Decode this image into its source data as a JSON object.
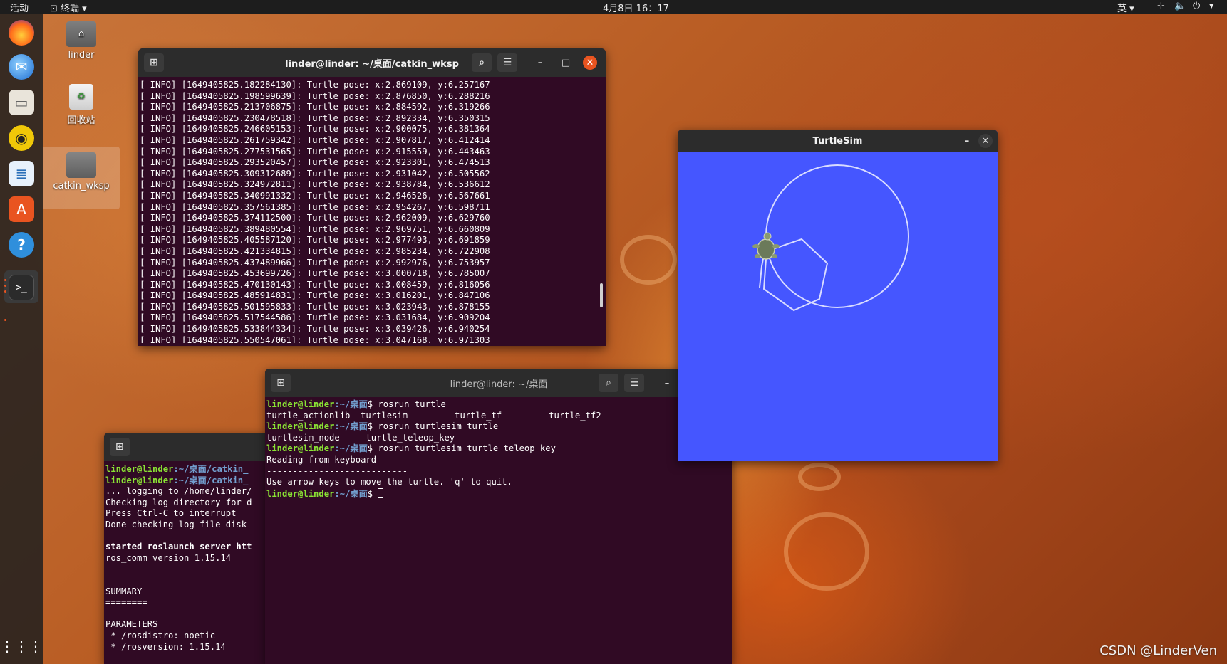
{
  "topbar": {
    "activities": "活动",
    "app_menu": "终端 ▾",
    "clock": "4月8日  16：17",
    "input_method": "英 ▾",
    "status_arrow": "▾"
  },
  "desktop": {
    "icons": [
      {
        "label": "linder"
      },
      {
        "label": "回收站"
      },
      {
        "label": "catkin_wksp"
      }
    ],
    "watermark": "CSDN @LinderVen"
  },
  "term1": {
    "title": "linder@linder: ~/桌面/catkin_wksp",
    "lines": [
      "[ INFO] [1649405825.182284130]: Turtle pose: x:2.869109, y:6.257167",
      "[ INFO] [1649405825.198599639]: Turtle pose: x:2.876850, y:6.288216",
      "[ INFO] [1649405825.213706875]: Turtle pose: x:2.884592, y:6.319266",
      "[ INFO] [1649405825.230478518]: Turtle pose: x:2.892334, y:6.350315",
      "[ INFO] [1649405825.246605153]: Turtle pose: x:2.900075, y:6.381364",
      "[ INFO] [1649405825.261759342]: Turtle pose: x:2.907817, y:6.412414",
      "[ INFO] [1649405825.277531565]: Turtle pose: x:2.915559, y:6.443463",
      "[ INFO] [1649405825.293520457]: Turtle pose: x:2.923301, y:6.474513",
      "[ INFO] [1649405825.309312689]: Turtle pose: x:2.931042, y:6.505562",
      "[ INFO] [1649405825.324972811]: Turtle pose: x:2.938784, y:6.536612",
      "[ INFO] [1649405825.340991332]: Turtle pose: x:2.946526, y:6.567661",
      "[ INFO] [1649405825.357561385]: Turtle pose: x:2.954267, y:6.598711",
      "[ INFO] [1649405825.374112500]: Turtle pose: x:2.962009, y:6.629760",
      "[ INFO] [1649405825.389480554]: Turtle pose: x:2.969751, y:6.660809",
      "[ INFO] [1649405825.405587120]: Turtle pose: x:2.977493, y:6.691859",
      "[ INFO] [1649405825.421334815]: Turtle pose: x:2.985234, y:6.722908",
      "[ INFO] [1649405825.437489966]: Turtle pose: x:2.992976, y:6.753957",
      "[ INFO] [1649405825.453699726]: Turtle pose: x:3.000718, y:6.785007",
      "[ INFO] [1649405825.470130143]: Turtle pose: x:3.008459, y:6.816056",
      "[ INFO] [1649405825.485914831]: Turtle pose: x:3.016201, y:6.847106",
      "[ INFO] [1649405825.501595833]: Turtle pose: x:3.023943, y:6.878155",
      "[ INFO] [1649405825.517544586]: Turtle pose: x:3.031684, y:6.909204",
      "[ INFO] [1649405825.533844334]: Turtle pose: x:3.039426, y:6.940254",
      "[ INFO] [1649405825.550547061]: Turtle pose: x:3.047168, y:6.971303"
    ]
  },
  "term2": {
    "title": "linder@linder: ~/桌面",
    "prompt_user": "linder@linder",
    "prompt_path": ":~/桌面",
    "cmd1": "$ rosrun turtle",
    "out1": "turtle_actionlib  turtlesim         turtle_tf         turtle_tf2",
    "cmd2": "$ rosrun turtlesim turtle",
    "out2": "turtlesim_node     turtle_teleop_key",
    "cmd3": "$ rosrun turtlesim turtle_teleop_key",
    "out3a": "Reading from keyboard",
    "out3b": "---------------------------",
    "out3c": "Use arrow keys to move the turtle. 'q' to quit.",
    "cmd4": "$ "
  },
  "term3": {
    "prompt_user": "linder@linder",
    "prompt_path1": ":~/桌面/catkin_",
    "prompt_path2": ":~/桌面/catkin_",
    "lines": [
      "... logging to /home/linder/",
      "Checking log directory for d",
      "Press Ctrl-C to interrupt",
      "Done checking log file disk"
    ],
    "started": "started roslaunch server htt",
    "version": "ros_comm version 1.15.14",
    "summary": "SUMMARY",
    "summary_rule": "========",
    "parameters": "PARAMETERS",
    "param1": " * /rosdistro: noetic",
    "param2": " * /rosversion: 1.15.14"
  },
  "turtlesim": {
    "title": "TurtleSim",
    "background": "#4556ff"
  }
}
